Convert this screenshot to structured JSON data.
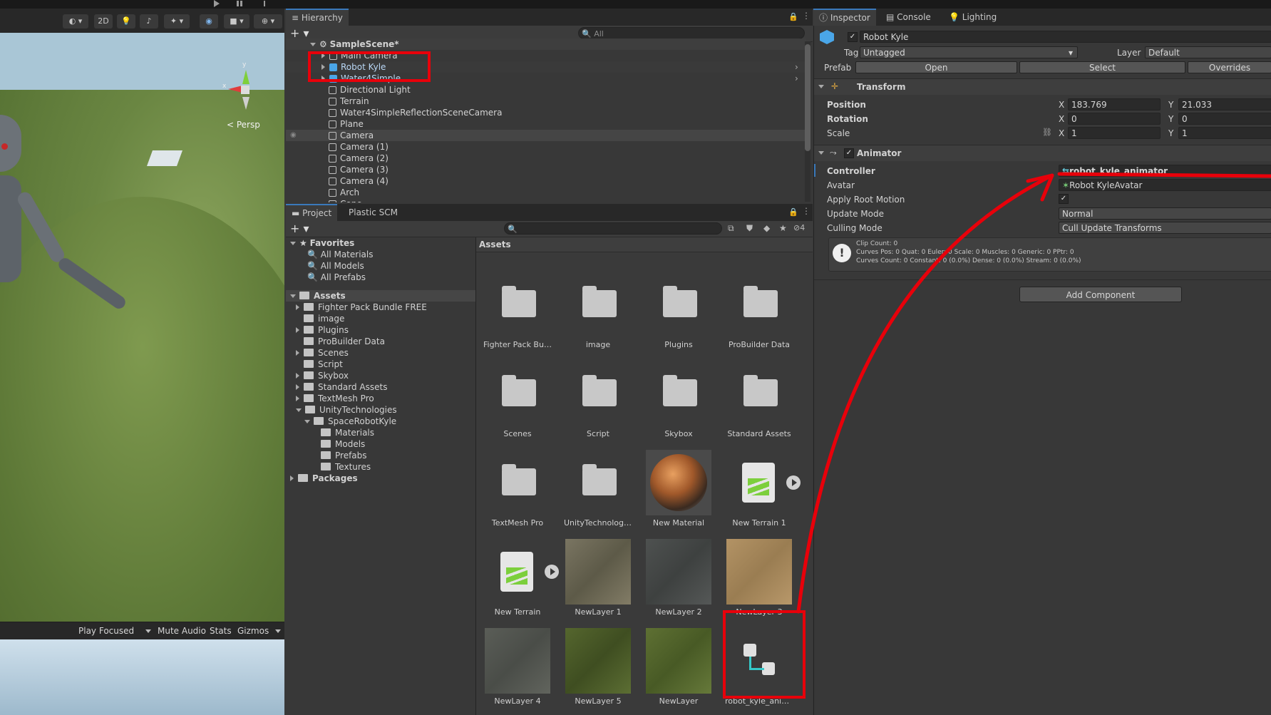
{
  "scene": {
    "toolbar": {
      "mode_2d": "2D"
    },
    "persp_label": "< Persp",
    "gizmo_y": "y",
    "gizmo_x": "x"
  },
  "game": {
    "play_focused": "Play Focused",
    "mute_audio": "Mute Audio",
    "stats": "Stats",
    "gizmos": "Gizmos"
  },
  "hierarchy": {
    "tab": "Hierarchy",
    "search_placeholder": "All",
    "scene_name": "SampleScene*",
    "items": [
      "Main Camera",
      "Robot Kyle",
      "Water4Simple",
      "Directional Light",
      "Terrain",
      "Water4SimpleReflectionSceneCamera",
      "Plane",
      "Camera",
      "Camera (1)",
      "Camera (2)",
      "Camera (3)",
      "Camera (4)",
      "Arch",
      "Cone"
    ]
  },
  "project": {
    "tabs": [
      "Project",
      "Plastic SCM"
    ],
    "hidden_count": "4",
    "favorites_label": "Favorites",
    "favorites": [
      "All Materials",
      "All Models",
      "All Prefabs"
    ],
    "assets_label": "Assets",
    "tree": [
      "Fighter Pack Bundle FREE",
      "image",
      "Plugins",
      "ProBuilder Data",
      "Scenes",
      "Script",
      "Skybox",
      "Standard Assets",
      "TextMesh Pro",
      "UnityTechnologies",
      "SpaceRobotKyle",
      "Materials",
      "Models",
      "Prefabs",
      "Textures"
    ],
    "packages_label": "Packages",
    "breadcrumb": "Assets",
    "grid": [
      "Fighter Pack Bund...",
      "image",
      "Plugins",
      "ProBuilder Data",
      "Scenes",
      "Script",
      "Skybox",
      "Standard Assets",
      "TextMesh Pro",
      "UnityTechnologies",
      "New Material",
      "New Terrain 1",
      "New Terrain",
      "NewLayer 1",
      "NewLayer 2",
      "NewLayer 3",
      "NewLayer 4",
      "NewLayer 5",
      "NewLayer",
      "robot_kyle_anima..."
    ]
  },
  "inspector": {
    "tabs": [
      "Inspector",
      "Console",
      "Lighting"
    ],
    "object_name": "Robot Kyle",
    "tag_label": "Tag",
    "tag_value": "Untagged",
    "layer_label": "Layer",
    "layer_value": "Default",
    "prefab_label": "Prefab",
    "prefab_open": "Open",
    "prefab_select": "Select",
    "prefab_overrides": "Overrides",
    "transform": {
      "title": "Transform",
      "position_label": "Position",
      "position_x": "183.769",
      "position_y": "21.033",
      "rotation_label": "Rotation",
      "rotation_x": "0",
      "rotation_y": "0",
      "scale_label": "Scale",
      "scale_x": "1",
      "scale_y": "1",
      "x": "X",
      "y": "Y"
    },
    "animator": {
      "title": "Animator",
      "controller_label": "Controller",
      "controller_value": "robot_kyle_animator",
      "avatar_label": "Avatar",
      "avatar_value": "Robot KyleAvatar",
      "root_motion_label": "Apply Root Motion",
      "update_mode_label": "Update Mode",
      "update_mode_value": "Normal",
      "culling_mode_label": "Culling Mode",
      "culling_mode_value": "Cull Update Transforms",
      "info_line1": "Clip Count: 0",
      "info_line2": "Curves Pos: 0 Quat: 0 Euler: 0 Scale: 0 Muscles: 0 Generic: 0 PPtr: 0",
      "info_line3": "Curves Count: 0 Constant: 0 (0.0%) Dense: 0 (0.0%) Stream: 0 (0.0%)"
    },
    "add_component": "Add Component"
  },
  "colors": {
    "highlight": "#e8000a",
    "accent": "#3a79bb",
    "selected": "#2c5d87"
  }
}
